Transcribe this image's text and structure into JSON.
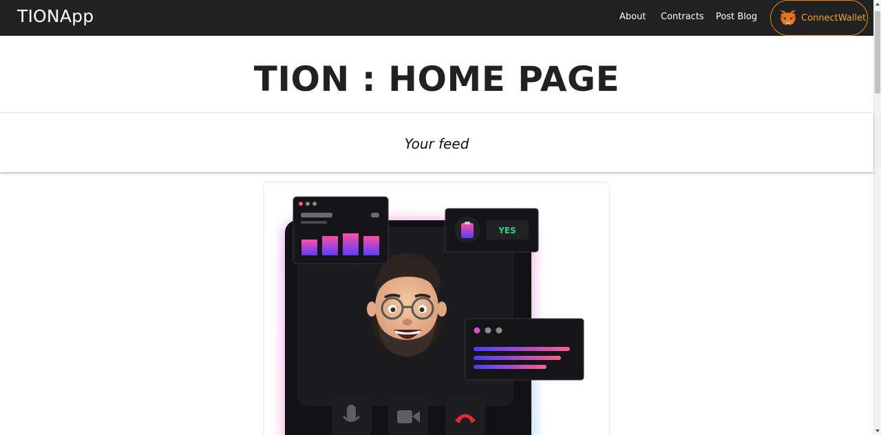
{
  "navbar": {
    "brand": "TIONApp",
    "links": [
      "About",
      "Contracts",
      "Post Blog"
    ],
    "wallet_label": "ConnectWallet"
  },
  "header": {
    "title": "TION : HOME PAGE",
    "subtitle": "Your feed"
  },
  "feed": {
    "illustration": {
      "vote_badge": "YES"
    }
  },
  "colors": {
    "navbar_bg": "#212121",
    "wallet_accent": "#f5a623",
    "yes_green": "#2bd37a"
  },
  "icons": [
    "metamask-fox-icon",
    "clipboard-icon",
    "microphone-icon",
    "video-camera-icon",
    "hang-up-icon"
  ]
}
